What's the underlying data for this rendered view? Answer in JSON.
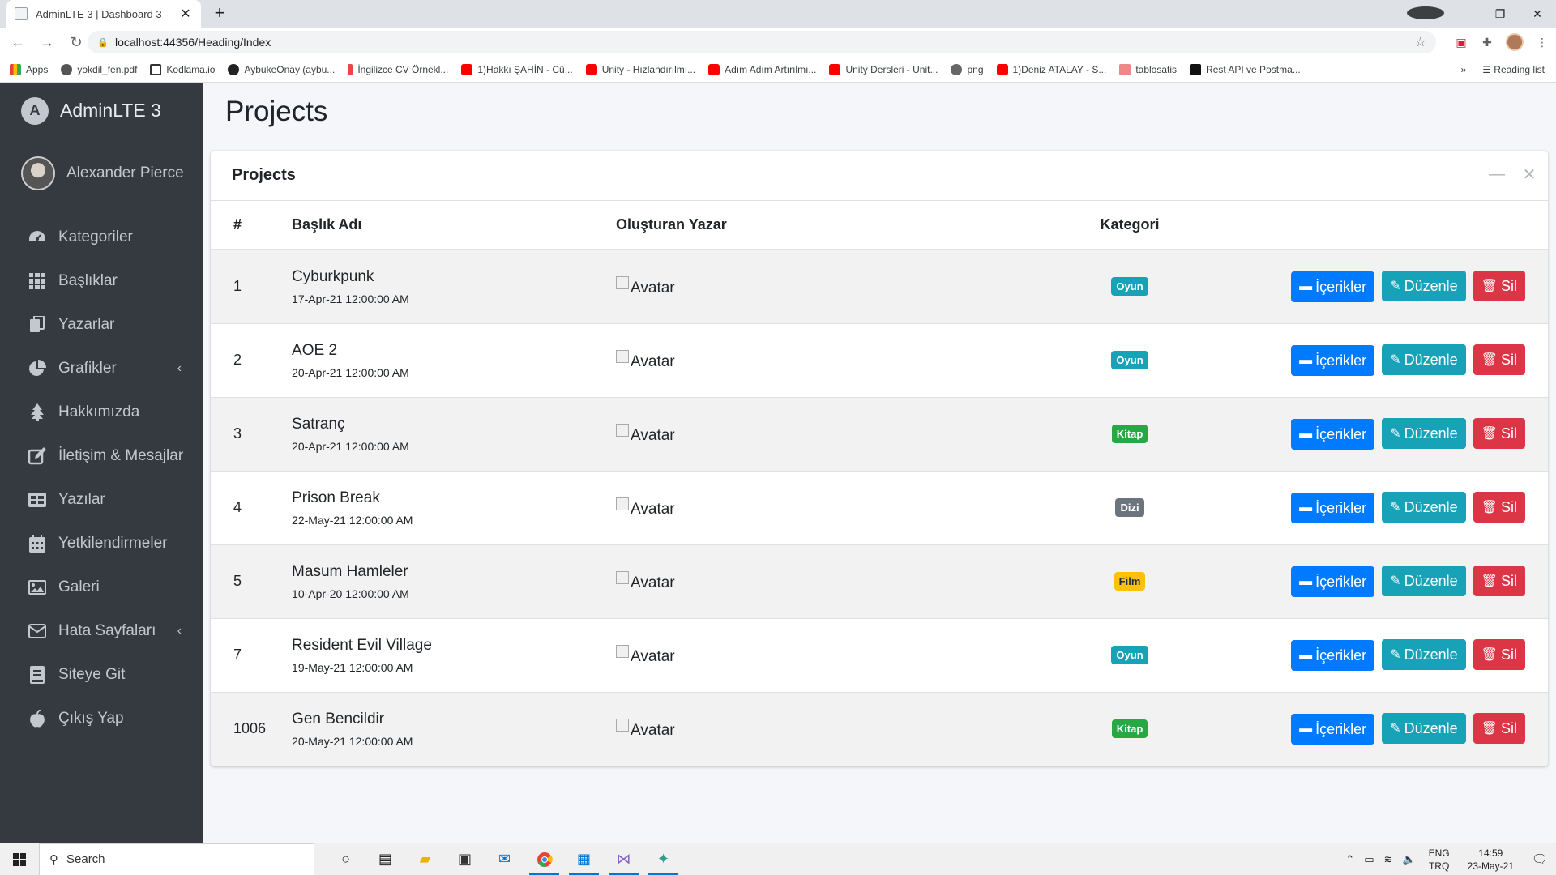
{
  "browser": {
    "tab_title": "AdminLTE 3 | Dashboard 3",
    "url": "localhost:44356/Heading/Index",
    "bookmarks": [
      "Apps",
      "yokdil_fen.pdf",
      "Kodlama.io",
      "AybukeOnay (aybu...",
      "İngilizce CV Örnekl...",
      "1)Hakkı ŞAHİN - Cü...",
      "Unity - Hızlandırılmı...",
      "Adım Adım Artırılmı...",
      "Unity Dersleri - Unit...",
      "png",
      "1)Deniz ATALAY - S...",
      "tablosatis",
      "Rest API ve Postma..."
    ],
    "bookmarks_more": "»",
    "reading_list": "Reading list"
  },
  "sidebar": {
    "brand": "AdminLTE 3",
    "user_name": "Alexander Pierce",
    "items": [
      {
        "label": "Kategoriler",
        "icon": "tachometer-icon"
      },
      {
        "label": "Başlıklar",
        "icon": "grid-icon"
      },
      {
        "label": "Yazarlar",
        "icon": "copy-icon"
      },
      {
        "label": "Grafikler",
        "icon": "pie-chart-icon",
        "chevron": "‹"
      },
      {
        "label": "Hakkımızda",
        "icon": "tree-icon"
      },
      {
        "label": "İletişim & Mesajlar",
        "icon": "edit-icon"
      },
      {
        "label": "Yazılar",
        "icon": "table-icon"
      },
      {
        "label": "Yetkilendirmeler",
        "icon": "calendar-icon"
      },
      {
        "label": "Galeri",
        "icon": "image-icon"
      },
      {
        "label": "Hata Sayfaları",
        "icon": "envelope-icon",
        "chevron": "‹"
      },
      {
        "label": "Siteye Git",
        "icon": "book-icon"
      },
      {
        "label": "Çıkış Yap",
        "icon": "apple-icon"
      }
    ]
  },
  "page": {
    "title": "Projects",
    "card_title": "Projects",
    "columns": [
      "#",
      "Başlık Adı",
      "Oluşturan Yazar",
      "Kategori",
      ""
    ],
    "buttons": {
      "contents": "İçerikler",
      "edit": "Düzenle",
      "delete": "Sil"
    },
    "rows": [
      {
        "id": "1",
        "title": "Cyburkpunk",
        "date": "17-Apr-21 12:00:00 AM",
        "author": "Avatar",
        "category": "Oyun",
        "category_color": "#17a2b8"
      },
      {
        "id": "2",
        "title": "AOE 2",
        "date": "20-Apr-21 12:00:00 AM",
        "author": "Avatar",
        "category": "Oyun",
        "category_color": "#17a2b8"
      },
      {
        "id": "3",
        "title": "Satranç",
        "date": "20-Apr-21 12:00:00 AM",
        "author": "Avatar",
        "category": "Kitap",
        "category_color": "#28a745"
      },
      {
        "id": "4",
        "title": "Prison Break",
        "date": "22-May-21 12:00:00 AM",
        "author": "Avatar",
        "category": "Dizi",
        "category_color": "#6c757d"
      },
      {
        "id": "5",
        "title": "Masum Hamleler",
        "date": "10-Apr-20 12:00:00 AM",
        "author": "Avatar",
        "category": "Film",
        "category_color": "#ffc107"
      },
      {
        "id": "7",
        "title": "Resident Evil Village",
        "date": "19-May-21 12:00:00 AM",
        "author": "Avatar",
        "category": "Oyun",
        "category_color": "#17a2b8"
      },
      {
        "id": "1006",
        "title": "Gen Bencildir",
        "date": "20-May-21 12:00:00 AM",
        "author": "Avatar",
        "category": "Kitap",
        "category_color": "#28a745"
      }
    ]
  },
  "taskbar": {
    "search_placeholder": "Search",
    "lang_top": "ENG",
    "lang_bottom": "TRQ",
    "time": "14:59",
    "date": "23-May-21"
  }
}
